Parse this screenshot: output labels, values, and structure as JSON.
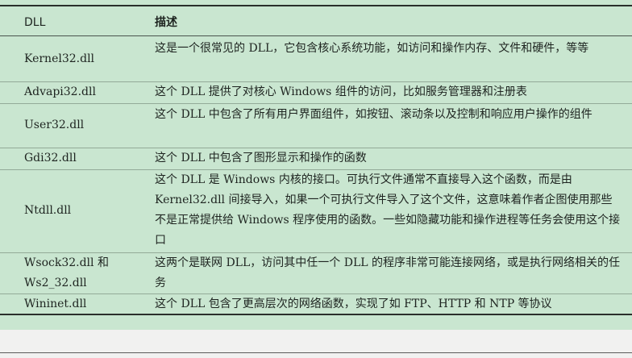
{
  "table": {
    "header": {
      "dll": "DLL",
      "description": "描述"
    },
    "rows": [
      {
        "name": "Kernel32.dll",
        "description": "这是一个很常见的 DLL，它包含核心系统功能，如访问和操作内存、文件和硬件，等等"
      },
      {
        "name": "Advapi32.dll",
        "description": "这个 DLL 提供了对核心 Windows 组件的访问，比如服务管理器和注册表"
      },
      {
        "name": "User32.dll",
        "description": "这个 DLL 中包含了所有用户界面组件，如按钮、滚动条以及控制和响应用户操作的组件"
      },
      {
        "name": "Gdi32.dll",
        "description": "这个 DLL 中包含了图形显示和操作的函数"
      },
      {
        "name": "Ntdll.dll",
        "description": "这个 DLL 是 Windows 内核的接口。可执行文件通常不直接导入这个函数，而是由 Kernel32.dll 间接导入，如果一个可执行文件导入了这个文件，这意味着作者企图使用那些不是正常提供给 Windows 程序使用的函数。一些如隐藏功能和操作进程等任务会使用这个接口"
      },
      {
        "name_line1": "Wsock32.dll 和",
        "name_line2": "Ws2_32.dll",
        "description": "这两个是联网 DLL，访问其中任一个 DLL 的程序非常可能连接网络，或是执行网络相关的任务"
      },
      {
        "name": "Wininet.dll",
        "description": "这个 DLL 包含了更高层次的网络函数，实现了如 FTP、HTTP 和 NTP 等协议"
      }
    ]
  }
}
